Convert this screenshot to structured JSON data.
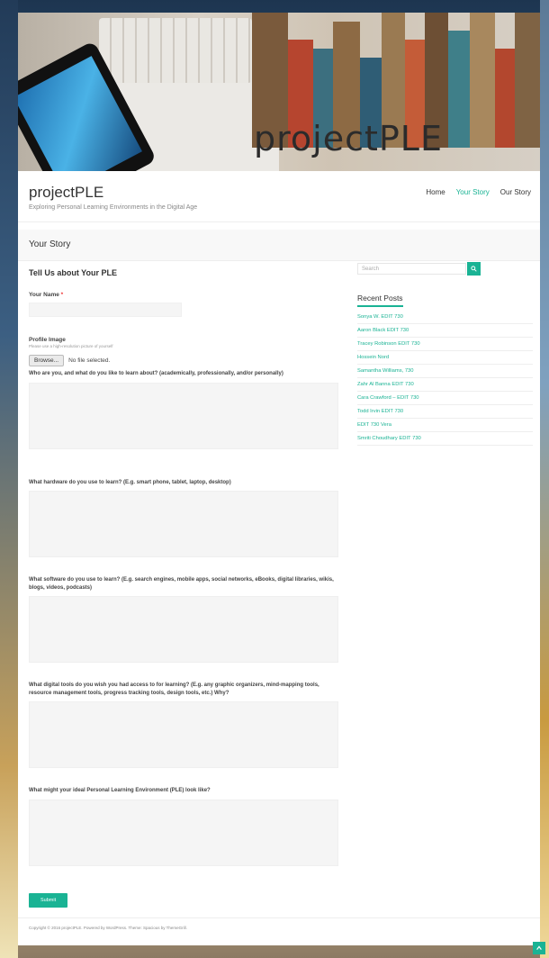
{
  "header": {
    "banner_title": "projectPLE",
    "site_title": "projectPLE",
    "site_description": "Exploring Personal Learning Environments in the Digital Age",
    "nav": [
      "Home",
      "Your Story",
      "Our Story"
    ],
    "active_nav": "Your Story"
  },
  "page": {
    "title": "Your Story"
  },
  "form": {
    "title": "Tell Us about Your PLE",
    "name_label": "Your Name",
    "required_mark": "*",
    "profile_label": "Profile Image",
    "profile_hint": "Please use a high-resolution picture of yourself",
    "browse_label": "Browse...",
    "file_status": "No file selected.",
    "q1": "Who are you, and what do you like to learn about? (academically, professionally, and/or personally)",
    "q2": "What hardware do you use to learn? (E.g. smart phone, tablet, laptop, desktop)",
    "q3": "What software do you use to learn? (E.g. search engines, mobile apps, social networks, eBooks, digital libraries, wikis, blogs, videos, podcasts)",
    "q4": "What digital tools do you wish you had access to for learning? (E.g. any graphic organizers, mind-mapping tools, resource management tools, progress tracking tools, design tools, etc.) Why?",
    "q5": "What might your ideal Personal Learning Environment (PLE) look like?",
    "submit_label": "Submit"
  },
  "sidebar": {
    "search_placeholder": "Search",
    "recent_title": "Recent Posts",
    "posts": [
      "Sonya W. EDIT 730",
      "Aaron Black EDIT 730",
      "Tracey Robinson EDIT 730",
      "Hossein Nord",
      "Samantha Williams, 730",
      "Zahr Al Banna EDIT 730",
      "Cara Crawford – EDIT 730",
      "Todd Irvin EDIT 730",
      "EDIT 730 Vera",
      "Smriti Choudhary EDIT 730"
    ]
  },
  "footer": {
    "text": "Copyright © 2016 projectPLE. Powered by WordPress. Theme: Spacious by ThemeGrill."
  },
  "colors": {
    "accent": "#1ab394"
  }
}
